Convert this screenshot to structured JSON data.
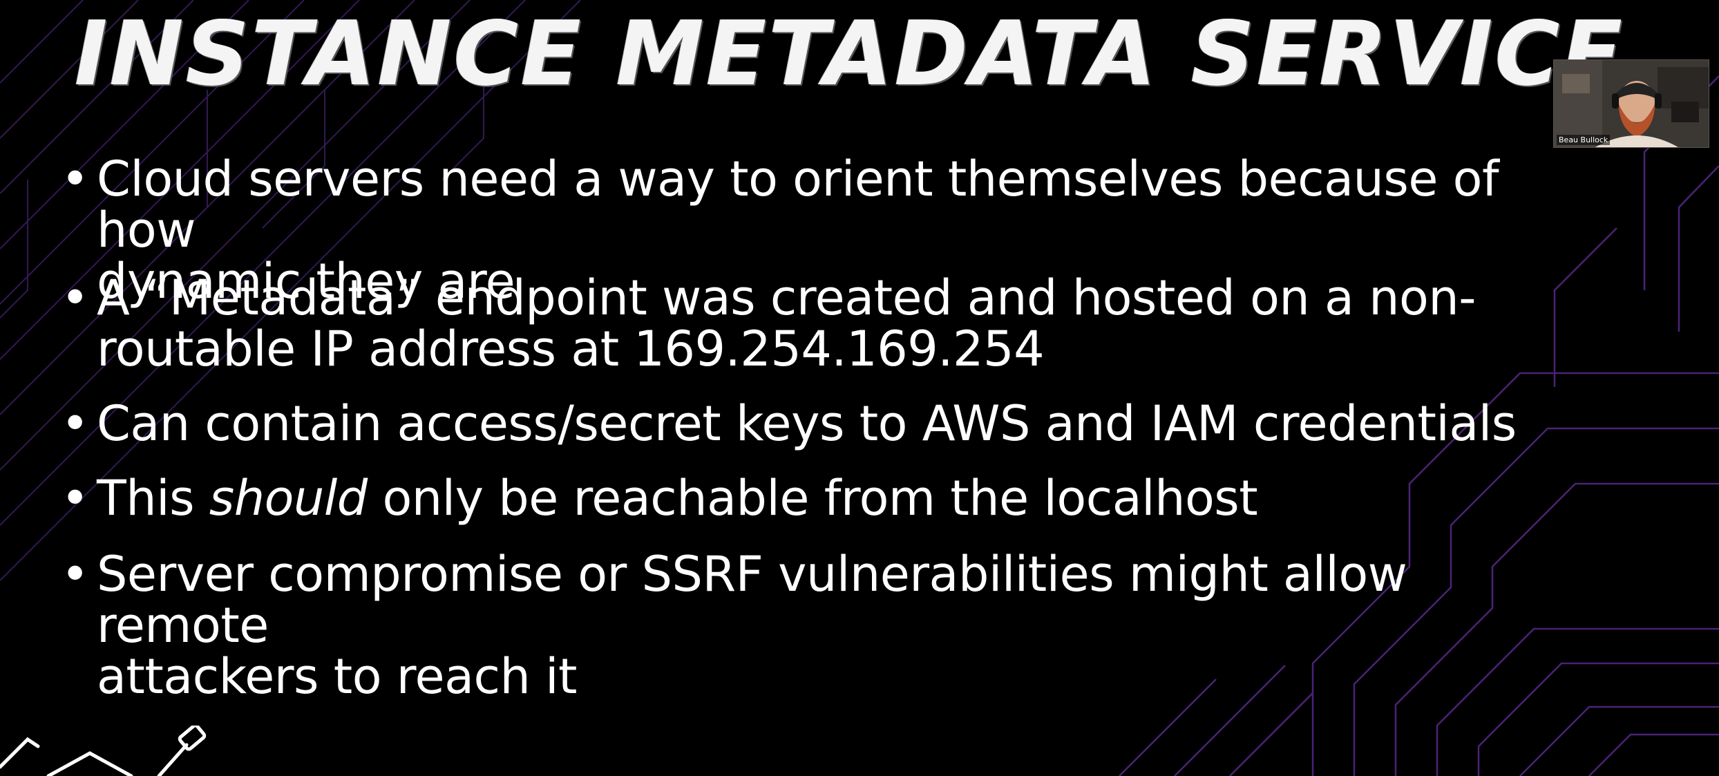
{
  "slide": {
    "title": "INSTANCE METADATA SERVICE",
    "bullets": [
      {
        "bullet_char": "•",
        "lines": [
          "Cloud servers need a way to orient themselves because of how",
          "dynamic they are"
        ]
      },
      {
        "bullet_char": "•",
        "lines": [
          "A “Metadata” endpoint was created and hosted on a non-",
          "routable IP address at 169.254.169.254"
        ]
      },
      {
        "bullet_char": "•",
        "lines": [
          "Can contain access/secret keys to AWS and IAM credentials"
        ]
      },
      {
        "bullet_char": "•",
        "before": "This ",
        "emphasis": "should",
        "after": " only be reachable from the localhost"
      },
      {
        "bullet_char": "•",
        "lines": [
          "Server compromise or SSRF vulnerabilities might allow remote",
          "attackers to reach it"
        ]
      }
    ]
  },
  "webcam": {
    "name": "Beau Bullock"
  },
  "colors": {
    "background": "#000000",
    "text": "#ffffff",
    "accent_lines": "#5a2a8a"
  },
  "icons": {
    "decor": "tools-icon"
  }
}
